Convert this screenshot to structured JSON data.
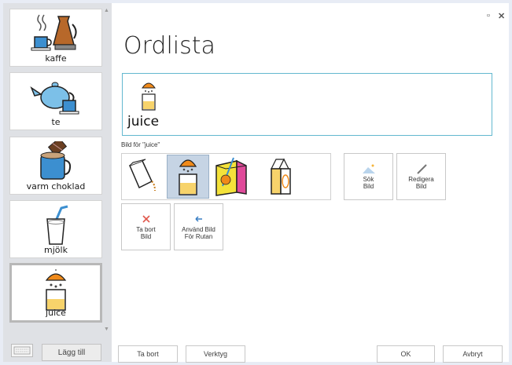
{
  "sidebar": {
    "items": [
      {
        "label": "kaffe",
        "icon": "coffee-pot-icon"
      },
      {
        "label": "te",
        "icon": "teapot-icon"
      },
      {
        "label": "varm choklad",
        "icon": "hot-chocolate-icon"
      },
      {
        "label": "mjölk",
        "icon": "milk-glass-icon"
      },
      {
        "label": "juice",
        "icon": "juice-icon",
        "selected": true
      }
    ],
    "add_label": "Lägg till"
  },
  "main": {
    "title": "Ordlista",
    "entry_word": "juice",
    "images_caption": "Bild för \"juice\"",
    "image_options": [
      {
        "icon": "carton-pour-icon"
      },
      {
        "icon": "juice-icon",
        "selected": true
      },
      {
        "icon": "juice-box-icon"
      },
      {
        "icon": "juice-carton-icon"
      }
    ],
    "search_image": {
      "line1": "Sök",
      "line2": "Bild"
    },
    "edit_image": {
      "line1": "Redigera",
      "line2": "Bild"
    },
    "remove_image": {
      "line1": "Ta bort",
      "line2": "Bild"
    },
    "use_image": {
      "line1": "Använd Bild",
      "line2": "För Rutan"
    }
  },
  "footer": {
    "delete_label": "Ta bort",
    "tools_label": "Verktyg",
    "ok_label": "OK",
    "cancel_label": "Avbryt"
  },
  "window": {
    "maximize_glyph": "▫",
    "close_glyph": "✕"
  },
  "colors": {
    "accent_border": "#63b8cf",
    "selection": "#c6d4e4",
    "delete_red": "#e0584c",
    "use_blue": "#3a7fc4"
  }
}
